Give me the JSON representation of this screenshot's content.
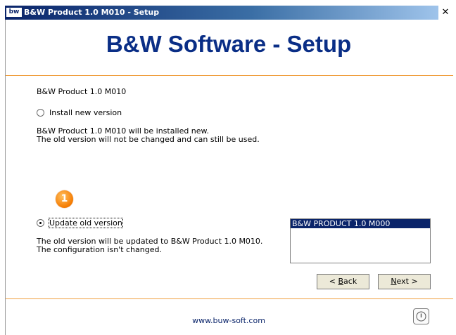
{
  "window": {
    "icon_text": "bw",
    "title": "B&W Product 1.0 M010 - Setup",
    "close_glyph": "✕"
  },
  "header": {
    "title": "B&W Software - Setup"
  },
  "main": {
    "product_name": "B&W Product 1.0 M010",
    "install_new": {
      "label": "Install new version",
      "checked": false,
      "desc_line1": "B&W Product 1.0 M010 will be installed new.",
      "desc_line2": "The old version will not be changed and can still be used."
    },
    "step_badge": "1",
    "update_old": {
      "label": "Update old version",
      "checked": true,
      "desc_line1": "The old version will be updated to B&W Product 1.0 M010.",
      "desc_line2": "The configuration isn't changed."
    },
    "versions_list": [
      "B&W PRODUCT 1.0 M000"
    ]
  },
  "buttons": {
    "back_prefix": "< ",
    "back_mnemonic": "B",
    "back_rest": "ack",
    "next_mnemonic": "N",
    "next_rest": "ext >"
  },
  "footer": {
    "link": "www.buw-soft.com",
    "power_icon": "power-icon"
  },
  "colors": {
    "title_accent": "#0a2e86",
    "rule": "#f0a040",
    "badge": "#f57b00",
    "selection": "#0a246a"
  }
}
